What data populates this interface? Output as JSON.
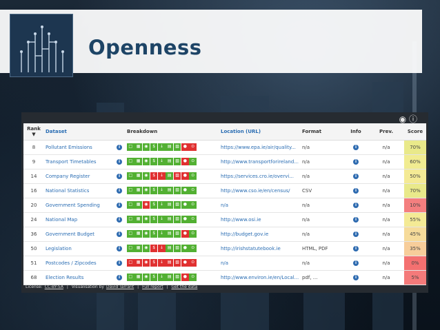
{
  "slide": {
    "title": "Openness"
  },
  "toolbar": {
    "github_icon": "github-icon",
    "help_icon": "help-icon"
  },
  "table": {
    "headers": {
      "rank": "Rank",
      "dataset": "Dataset",
      "breakdown": "Breakdown",
      "location": "Location (URL)",
      "format": "Format",
      "info": "Info",
      "prev": "Prev.",
      "score": "Score"
    },
    "rows": [
      {
        "rank": "8",
        "dataset": "Pollutant Emissions",
        "breakdown": [
          "g",
          "g",
          "g",
          "g",
          "g",
          "g",
          "g",
          "r",
          "r"
        ],
        "location": "https://www.epa.ie/air/quality...",
        "format": "n/a",
        "prev": "n/a",
        "score": "70%",
        "score_color": "#e9e98a"
      },
      {
        "rank": "9",
        "dataset": "Transport Timetables",
        "breakdown": [
          "g",
          "g",
          "g",
          "g",
          "g",
          "g",
          "g",
          "r",
          "g"
        ],
        "location": "http://www.transportforireland...",
        "format": "n/a",
        "prev": "n/a",
        "score": "60%",
        "score_color": "#f1ec91"
      },
      {
        "rank": "14",
        "dataset": "Company Register",
        "breakdown": [
          "g",
          "g",
          "g",
          "r",
          "r",
          "g",
          "r",
          "r",
          "g"
        ],
        "location": "https://services.cro.ie/overvi...",
        "format": "n/a",
        "prev": "n/a",
        "score": "50%",
        "score_color": "#f4ea95"
      },
      {
        "rank": "16",
        "dataset": "National Statistics",
        "breakdown": [
          "g",
          "g",
          "g",
          "g",
          "g",
          "g",
          "g",
          "g",
          "g"
        ],
        "location": "http://www.cso.ie/en/census/",
        "format": "CSV",
        "prev": "n/a",
        "score": "70%",
        "score_color": "#e9e98a"
      },
      {
        "rank": "20",
        "dataset": "Government Spending",
        "breakdown": [
          "g",
          "g",
          "r",
          "g",
          "g",
          "g",
          "g",
          "g",
          "g"
        ],
        "location": "n/a",
        "format": "n/a",
        "prev": "n/a",
        "score": "10%",
        "score_color": "#f47f7f"
      },
      {
        "rank": "24",
        "dataset": "National Map",
        "breakdown": [
          "g",
          "g",
          "g",
          "g",
          "g",
          "g",
          "g",
          "g",
          "g"
        ],
        "location": "http://www.osi.ie",
        "format": "n/a",
        "prev": "n/a",
        "score": "55%",
        "score_color": "#f4ea95"
      },
      {
        "rank": "36",
        "dataset": "Government Budget",
        "breakdown": [
          "g",
          "g",
          "g",
          "g",
          "g",
          "g",
          "g",
          "r",
          "g"
        ],
        "location": "http://budget.gov.ie",
        "format": "n/a",
        "prev": "n/a",
        "score": "45%",
        "score_color": "#f6db9a"
      },
      {
        "rank": "50",
        "dataset": "Legislation",
        "breakdown": [
          "g",
          "g",
          "g",
          "r",
          "r",
          "g",
          "g",
          "g",
          "g"
        ],
        "location": "http://irishstatutebook.ie",
        "format": "HTML, PDF",
        "prev": "n/a",
        "score": "35%",
        "score_color": "#f7cd9a"
      },
      {
        "rank": "51",
        "dataset": "Postcodes / Zipcodes",
        "breakdown": [
          "r",
          "r",
          "r",
          "r",
          "r",
          "r",
          "r",
          "r",
          "r"
        ],
        "location": "n/a",
        "format": "n/a",
        "prev": "n/a",
        "score": "0%",
        "score_color": "#f47070"
      },
      {
        "rank": "68",
        "dataset": "Election Results",
        "breakdown": [
          "g",
          "g",
          "g",
          "g",
          "g",
          "g",
          "g",
          "r",
          "g"
        ],
        "location": "http://www.environ.ie/en/Local...",
        "format": "pdf, ...",
        "prev": "n/a",
        "score": "5%",
        "score_color": "#f47a7a"
      }
    ]
  },
  "footer": {
    "license_label": "License:",
    "license_link": "CC-BY-SA",
    "viz_label": "Visualisation by",
    "viz_author": "David Tarrant",
    "sep": "|",
    "full_report": "Full report",
    "get_data": "Get the data"
  },
  "colors": {
    "green": "#52b032",
    "red": "#e03030",
    "link": "#2a6db3"
  }
}
